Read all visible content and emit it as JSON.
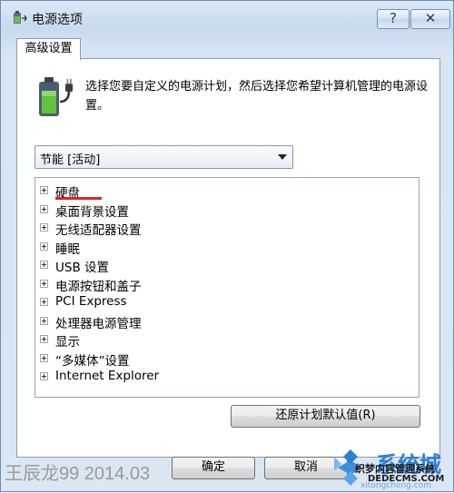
{
  "window": {
    "title": "电源选项",
    "help_label": "?",
    "close_label": "✕",
    "app_icon": "power-options-icon"
  },
  "tab": {
    "label": "高级设置"
  },
  "description": "选择您要自定义的电源计划，然后选择您希望计算机管理的电源设置。",
  "plan_select": {
    "value": "节能 [活动]"
  },
  "tree_items": [
    {
      "label": "硬盘"
    },
    {
      "label": "桌面背景设置"
    },
    {
      "label": "无线适配器设置"
    },
    {
      "label": "睡眠"
    },
    {
      "label": "USB 设置"
    },
    {
      "label": "电源按钮和盖子"
    },
    {
      "label": "PCI Express"
    },
    {
      "label": "处理器电源管理"
    },
    {
      "label": "显示"
    },
    {
      "label": "“多媒体”设置"
    },
    {
      "label": "Internet Explorer"
    }
  ],
  "buttons": {
    "restore_label": "还原计划默认值(R)",
    "ok_label": "确定",
    "cancel_label": "取消"
  },
  "watermark": {
    "left_text": "王辰龙99 2014.03",
    "logo_cn": "系统城",
    "logo_sub": "织梦内容管理系统",
    "logo_url": "DEDECMS.COM",
    "logo_url2": "xitongcheng.com"
  },
  "colors": {
    "title_bar": "#c9daee",
    "accent_red_underline": "#d8252a",
    "logo_blue": "#2c7fd1"
  }
}
